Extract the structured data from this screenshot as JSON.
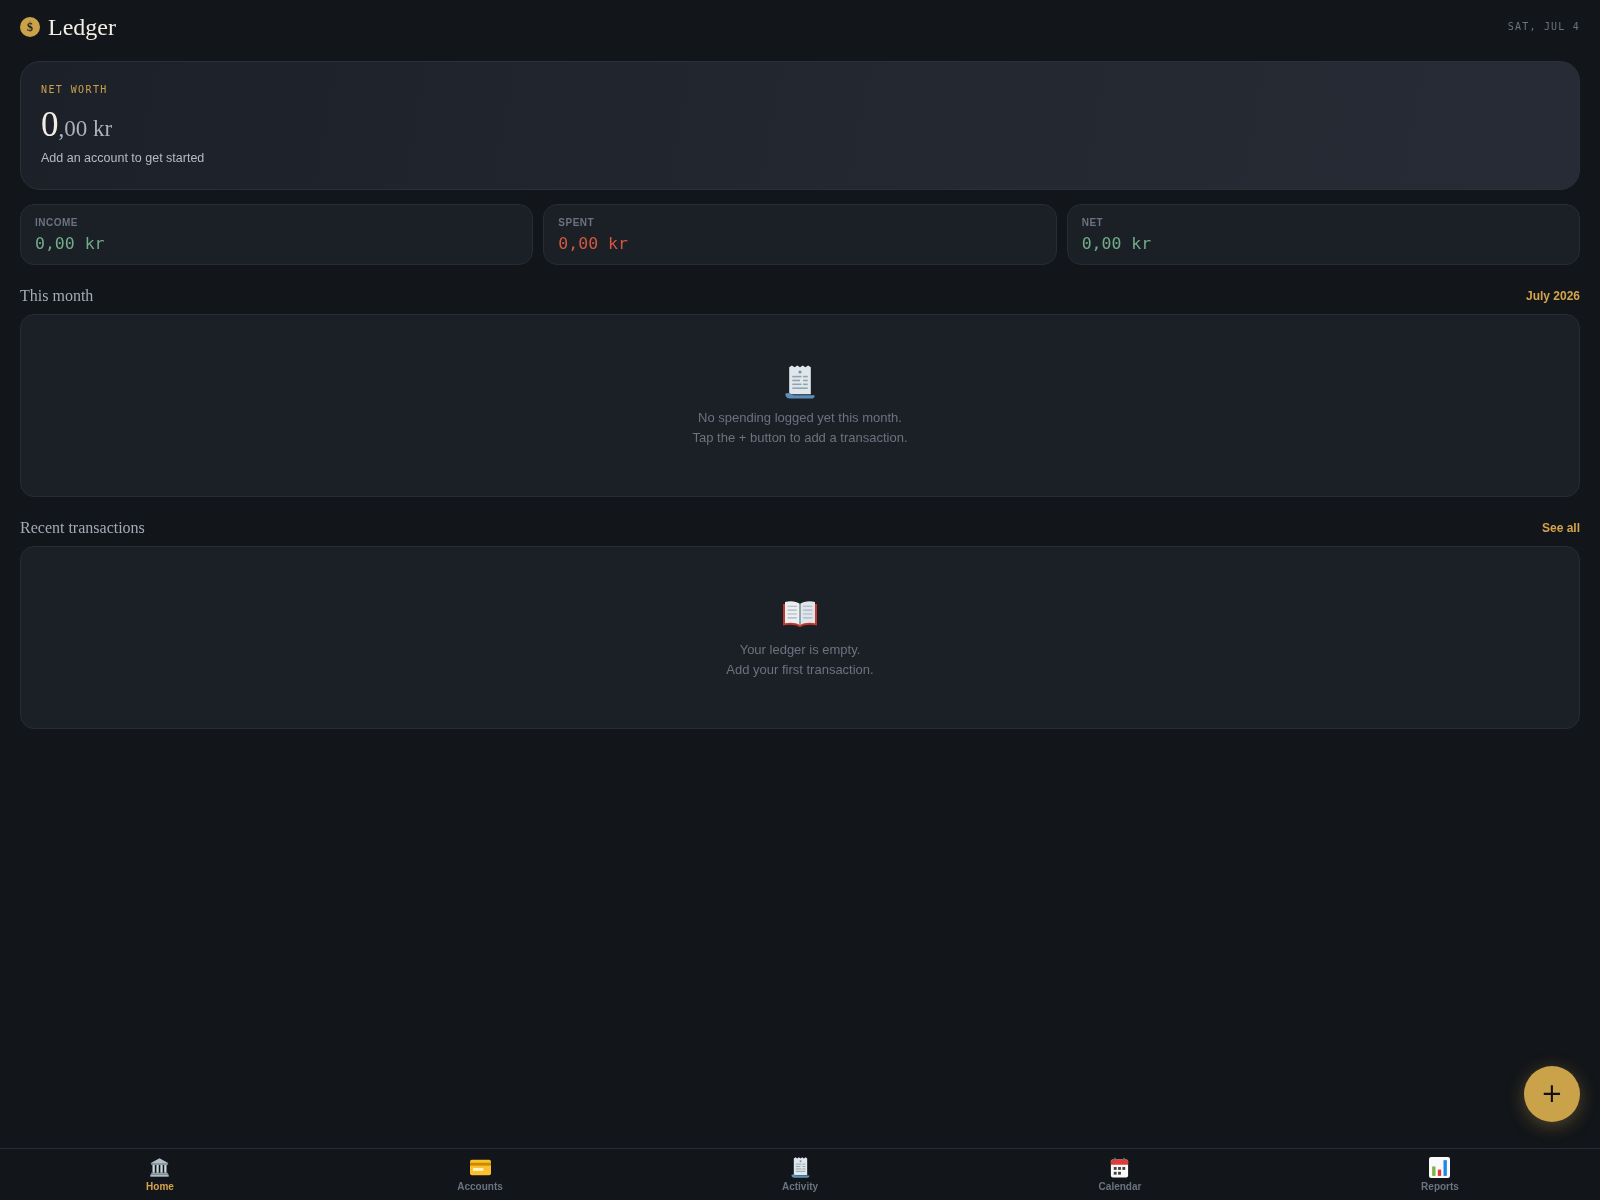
{
  "header": {
    "logo_symbol": "$",
    "title": "Ledger",
    "date": "SAT, JUL 4"
  },
  "net_worth": {
    "label": "NET WORTH",
    "amount_major": "0",
    "amount_minor": ",00 kr",
    "hint": "Add an account to get started"
  },
  "stats": [
    {
      "label": "INCOME",
      "value": "0,00 kr",
      "kind": "positive"
    },
    {
      "label": "SPENT",
      "value": "0,00 kr",
      "kind": "negative"
    },
    {
      "label": "NET",
      "value": "0,00 kr",
      "kind": "positive"
    }
  ],
  "sections": [
    {
      "title": "This month",
      "action": "July 2026",
      "empty_lines": [
        "No spending logged yet this month.",
        "Tap the + button to add a transaction."
      ]
    },
    {
      "title": "Recent transactions",
      "action": "See all",
      "empty_lines": [
        "Your ledger is empty.",
        "Add your first transaction."
      ]
    }
  ],
  "fab": {
    "label": "+"
  },
  "nav": {
    "items": [
      {
        "label": "Home",
        "selected": true
      },
      {
        "label": "Accounts",
        "selected": false
      },
      {
        "label": "Activity",
        "selected": false
      },
      {
        "label": "Calendar",
        "selected": false
      },
      {
        "label": "Reports",
        "selected": false
      }
    ]
  }
}
